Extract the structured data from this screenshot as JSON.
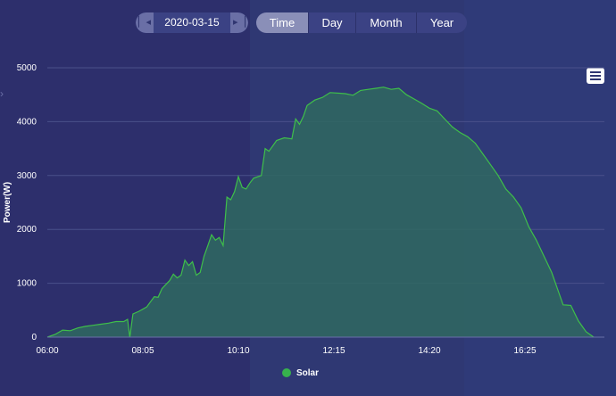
{
  "controls": {
    "date": "2020-03-15",
    "prev_icon": "first-page-icon",
    "next_icon": "last-page-icon",
    "tabs": [
      {
        "label": "Time",
        "active": true
      },
      {
        "label": "Day",
        "active": false
      },
      {
        "label": "Month",
        "active": false
      },
      {
        "label": "Year",
        "active": false
      }
    ],
    "menu_icon": "hamburger-menu-icon"
  },
  "chart_data": {
    "type": "area",
    "title": "",
    "xlabel": "",
    "ylabel": "Power(W)",
    "ylim": [
      0,
      5000
    ],
    "yticks": [
      "0",
      "1000",
      "2000",
      "3000",
      "4000",
      "5000"
    ],
    "xticks": [
      "06:00",
      "08:05",
      "10:10",
      "12:15",
      "14:20",
      "16:25"
    ],
    "grid": true,
    "legend_position": "bottom",
    "colors": {
      "line": "#3fbf4a",
      "fill": "#2f6860",
      "grid": "#4a508a"
    },
    "series": [
      {
        "name": "Solar",
        "points": [
          [
            "06:00",
            0
          ],
          [
            "06:10",
            50
          ],
          [
            "06:20",
            130
          ],
          [
            "06:30",
            120
          ],
          [
            "06:40",
            170
          ],
          [
            "06:50",
            200
          ],
          [
            "07:00",
            220
          ],
          [
            "07:10",
            240
          ],
          [
            "07:20",
            260
          ],
          [
            "07:30",
            290
          ],
          [
            "07:40",
            290
          ],
          [
            "07:45",
            330
          ],
          [
            "07:48",
            0
          ],
          [
            "07:52",
            430
          ],
          [
            "08:00",
            480
          ],
          [
            "08:10",
            560
          ],
          [
            "08:20",
            750
          ],
          [
            "08:25",
            740
          ],
          [
            "08:30",
            900
          ],
          [
            "08:40",
            1050
          ],
          [
            "08:45",
            1170
          ],
          [
            "08:50",
            1100
          ],
          [
            "08:55",
            1150
          ],
          [
            "09:00",
            1430
          ],
          [
            "09:05",
            1330
          ],
          [
            "09:10",
            1400
          ],
          [
            "09:15",
            1150
          ],
          [
            "09:20",
            1200
          ],
          [
            "09:25",
            1500
          ],
          [
            "09:30",
            1700
          ],
          [
            "09:35",
            1900
          ],
          [
            "09:40",
            1800
          ],
          [
            "09:45",
            1850
          ],
          [
            "09:50",
            1700
          ],
          [
            "09:55",
            2600
          ],
          [
            "10:00",
            2550
          ],
          [
            "10:05",
            2700
          ],
          [
            "10:10",
            2980
          ],
          [
            "10:15",
            2780
          ],
          [
            "10:20",
            2750
          ],
          [
            "10:25",
            2860
          ],
          [
            "10:30",
            2950
          ],
          [
            "10:40",
            3000
          ],
          [
            "10:45",
            3500
          ],
          [
            "10:50",
            3450
          ],
          [
            "10:55",
            3550
          ],
          [
            "11:00",
            3650
          ],
          [
            "11:10",
            3700
          ],
          [
            "11:20",
            3680
          ],
          [
            "11:25",
            4050
          ],
          [
            "11:30",
            3950
          ],
          [
            "11:35",
            4100
          ],
          [
            "11:40",
            4300
          ],
          [
            "11:50",
            4400
          ],
          [
            "12:00",
            4450
          ],
          [
            "12:10",
            4540
          ],
          [
            "12:30",
            4520
          ],
          [
            "12:40",
            4490
          ],
          [
            "12:50",
            4580
          ],
          [
            "13:00",
            4600
          ],
          [
            "13:10",
            4620
          ],
          [
            "13:20",
            4640
          ],
          [
            "13:30",
            4600
          ],
          [
            "13:40",
            4620
          ],
          [
            "13:50",
            4500
          ],
          [
            "14:00",
            4420
          ],
          [
            "14:10",
            4340
          ],
          [
            "14:20",
            4250
          ],
          [
            "14:30",
            4200
          ],
          [
            "14:40",
            4050
          ],
          [
            "14:50",
            3900
          ],
          [
            "15:00",
            3800
          ],
          [
            "15:10",
            3720
          ],
          [
            "15:20",
            3600
          ],
          [
            "15:30",
            3400
          ],
          [
            "15:40",
            3200
          ],
          [
            "15:50",
            3000
          ],
          [
            "16:00",
            2750
          ],
          [
            "16:10",
            2600
          ],
          [
            "16:20",
            2400
          ],
          [
            "16:30",
            2050
          ],
          [
            "16:40",
            1800
          ],
          [
            "16:50",
            1500
          ],
          [
            "17:00",
            1200
          ],
          [
            "17:10",
            800
          ],
          [
            "17:15",
            600
          ],
          [
            "17:25",
            590
          ],
          [
            "17:35",
            300
          ],
          [
            "17:45",
            100
          ],
          [
            "17:55",
            0
          ]
        ]
      }
    ]
  }
}
